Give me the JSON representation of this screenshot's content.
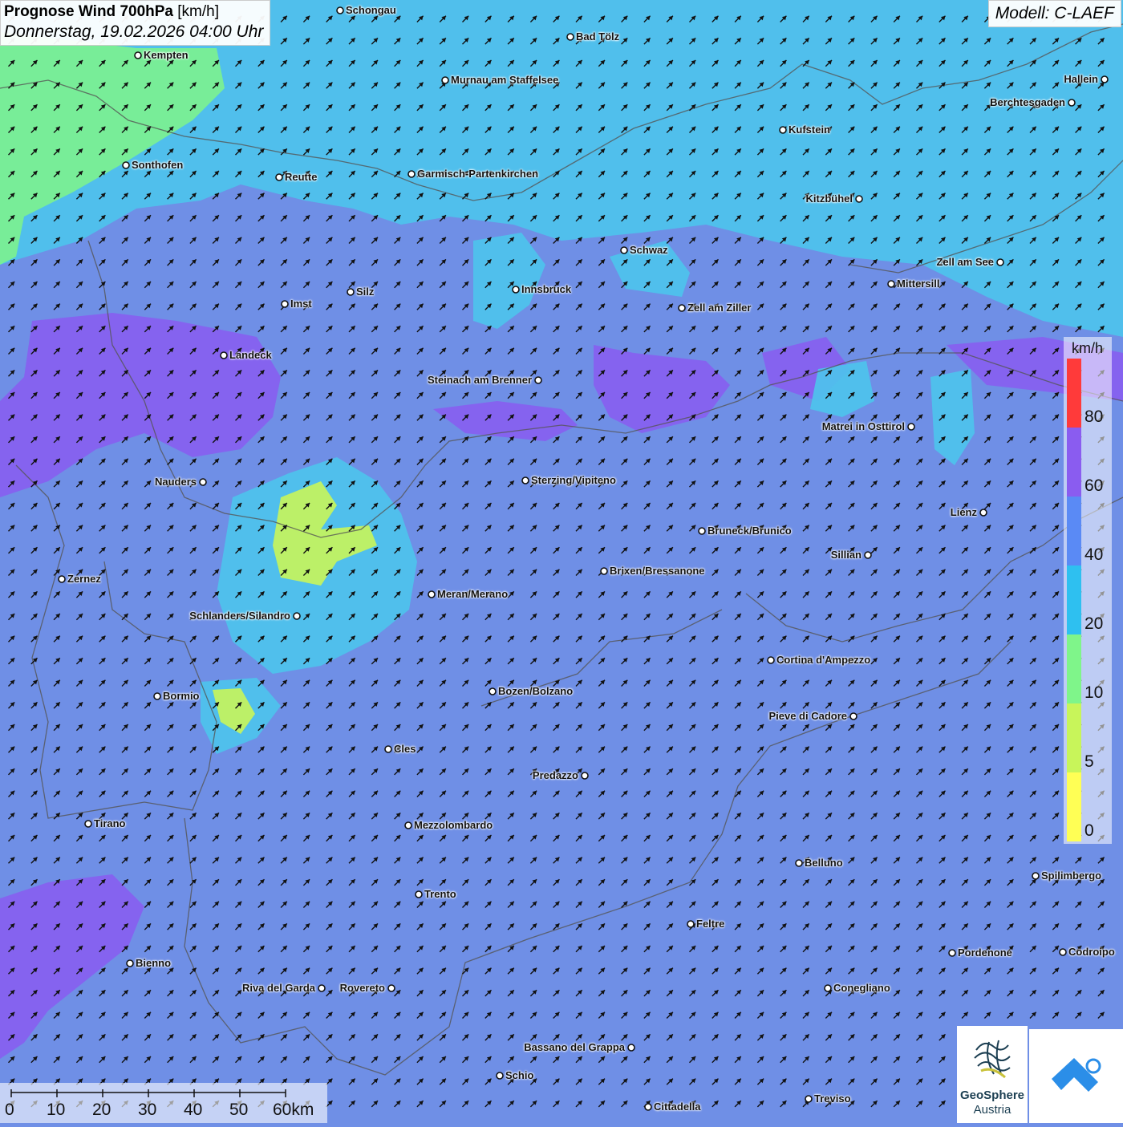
{
  "header": {
    "title_bold": "Prognose Wind 700hPa",
    "title_unit": " [km/h]",
    "subtitle": "Donnerstag, 19.02.2026 04:00 Uhr",
    "model": "Modell: C-LAEF"
  },
  "legend": {
    "unit": "km/h",
    "ticks": [
      "80",
      "60",
      "40",
      "20",
      "10",
      "5",
      "0"
    ],
    "colors": [
      "#ff3a3a",
      "#8a5cf0",
      "#5a8af5",
      "#2ec0f0",
      "#7ff58a",
      "#c8f55a",
      "#ffff55"
    ]
  },
  "scalebar": {
    "labels": [
      "0",
      "10",
      "20",
      "30",
      "40",
      "50",
      "60km"
    ]
  },
  "logos": {
    "geosphere_line1": "GeoSphere",
    "geosphere_line2": "Austria"
  },
  "wind": {
    "direction_deg": 45,
    "field_color": "#6f8fe6"
  },
  "cities": [
    {
      "name": "Schongau"
    },
    {
      "name": "Bad Tölz"
    },
    {
      "name": "Kempten"
    },
    {
      "name": "Murnau am Staffelsee"
    },
    {
      "name": "Hallein"
    },
    {
      "name": "Berchtesgaden"
    },
    {
      "name": "Kufstein"
    },
    {
      "name": "Sonthofen"
    },
    {
      "name": "Reutte"
    },
    {
      "name": "Garmisch-Partenkirchen"
    },
    {
      "name": "Kitzbühel"
    },
    {
      "name": "Schwaz"
    },
    {
      "name": "Zell am See"
    },
    {
      "name": "Mittersill"
    },
    {
      "name": "Innsbruck"
    },
    {
      "name": "Silz"
    },
    {
      "name": "Imst"
    },
    {
      "name": "Zell am Ziller"
    },
    {
      "name": "Landeck"
    },
    {
      "name": "Steinach am Brenner"
    },
    {
      "name": "Matrei in Osttirol"
    },
    {
      "name": "Nauders"
    },
    {
      "name": "Sterzing/Vipiteno"
    },
    {
      "name": "Lienz"
    },
    {
      "name": "Bruneck/Brunico"
    },
    {
      "name": "Sillian"
    },
    {
      "name": "Brixen/Bressanone"
    },
    {
      "name": "Zernez"
    },
    {
      "name": "Meran/Merano"
    },
    {
      "name": "Schlanders/Silandro"
    },
    {
      "name": "Cortina d'Ampezzo"
    },
    {
      "name": "Bozen/Bolzano"
    },
    {
      "name": "Bormio"
    },
    {
      "name": "Pieve di Cadore"
    },
    {
      "name": "Cles"
    },
    {
      "name": "Predazzo"
    },
    {
      "name": "Tirano"
    },
    {
      "name": "Mezzolombardo"
    },
    {
      "name": "Belluno"
    },
    {
      "name": "Spilimbergo"
    },
    {
      "name": "Trento"
    },
    {
      "name": "Feltre"
    },
    {
      "name": "Bienno"
    },
    {
      "name": "Pordenone"
    },
    {
      "name": "Codroipo"
    },
    {
      "name": "Riva del Garda"
    },
    {
      "name": "Rovereto"
    },
    {
      "name": "Conegliano"
    },
    {
      "name": "Bassano del Grappa"
    },
    {
      "name": "Schio"
    },
    {
      "name": "Treviso"
    },
    {
      "name": "Cittadella"
    }
  ]
}
